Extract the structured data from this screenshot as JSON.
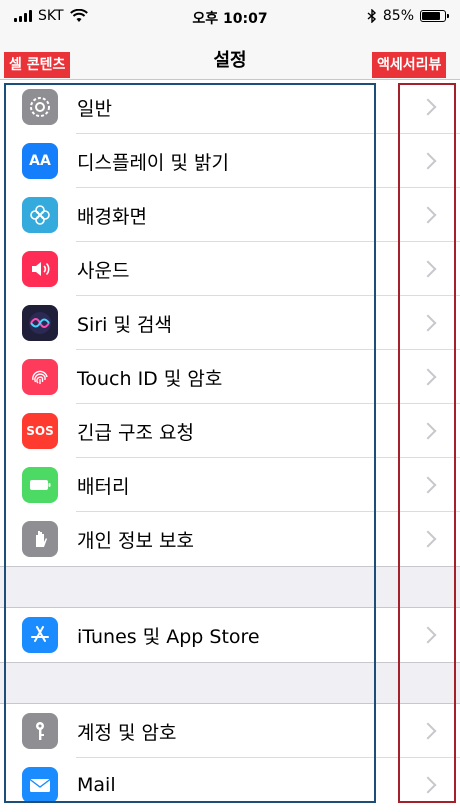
{
  "status_bar": {
    "carrier": "SKT",
    "time": "오후 10:07",
    "battery_percent": "85%",
    "battery_level": 0.85
  },
  "nav": {
    "title": "설정"
  },
  "annotations": {
    "content_tag": "셀 콘텐츠",
    "accessory_tag": "액세서리뷰"
  },
  "colors": {
    "general": "#8e8e93",
    "display": "#157efb",
    "wallpaper": "#35aadc",
    "sounds": "#ff2d55",
    "siri": "#1f1f3a",
    "touch_id": "#ff3b5c",
    "sos": "#ff3b30",
    "battery": "#4cd964",
    "privacy": "#8e8e93",
    "app_store": "#1a8cff",
    "passwords": "#8e8e93",
    "mail": "#1a8cff"
  },
  "settings": {
    "group1": [
      {
        "label": "일반",
        "icon": "gear-icon"
      },
      {
        "label": "디스플레이 및 밝기",
        "icon": "text-size-icon",
        "icon_text": "AA"
      },
      {
        "label": "배경화면",
        "icon": "flower-icon"
      },
      {
        "label": "사운드",
        "icon": "speaker-icon"
      },
      {
        "label": "Siri 및 검색",
        "icon": "siri-icon"
      },
      {
        "label": "Touch ID 및 암호",
        "icon": "fingerprint-icon"
      },
      {
        "label": "긴급 구조 요청",
        "icon": "sos-icon",
        "icon_text": "SOS"
      },
      {
        "label": "배터리",
        "icon": "battery-icon"
      },
      {
        "label": "개인 정보 보호",
        "icon": "hand-icon"
      }
    ],
    "group2": [
      {
        "label": "iTunes 및 App Store",
        "icon": "app-store-icon"
      }
    ],
    "group3": [
      {
        "label": "계정 및 암호",
        "icon": "key-icon"
      },
      {
        "label": "Mail",
        "icon": "mail-icon"
      }
    ]
  }
}
